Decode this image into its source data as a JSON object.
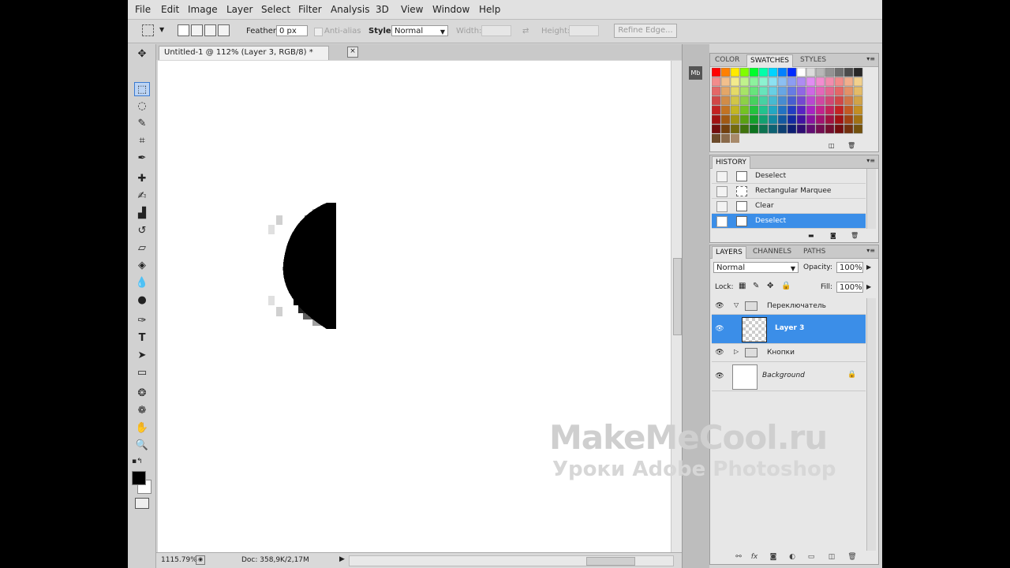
{
  "menu": [
    "File",
    "Edit",
    "Image",
    "Layer",
    "Select",
    "Filter",
    "Analysis",
    "3D",
    "View",
    "Window",
    "Help"
  ],
  "options": {
    "feather_label": "Feather:",
    "feather_value": "0 px",
    "antialias_label": "Anti-alias",
    "style_label": "Style:",
    "style_value": "Normal",
    "width_label": "Width:",
    "height_label": "Height:",
    "refine_edge": "Refine Edge..."
  },
  "document": {
    "tab_title": "Untitled-1 @ 112% (Layer 3, RGB/8) *",
    "zoom_status": "1115.79%",
    "doc_status": "Doc: 358,9K/2,17M"
  },
  "swatches_panel": {
    "tabs": [
      "COLOR",
      "SWATCHES",
      "STYLES"
    ],
    "active_tab": "SWATCHES"
  },
  "history_panel": {
    "title": "HISTORY",
    "items": [
      {
        "label": "Deselect",
        "active": false
      },
      {
        "label": "Rectangular Marquee",
        "active": false
      },
      {
        "label": "Clear",
        "active": false
      },
      {
        "label": "Deselect",
        "active": true
      }
    ]
  },
  "layers_panel": {
    "tabs": [
      "LAYERS",
      "CHANNELS",
      "PATHS"
    ],
    "blend_mode": "Normal",
    "opacity_label": "Opacity:",
    "opacity_value": "100%",
    "lock_label": "Lock:",
    "fill_label": "Fill:",
    "fill_value": "100%",
    "layers": [
      {
        "name": "Переключатель",
        "type": "group",
        "expanded": true
      },
      {
        "name": "Layer 3",
        "type": "layer",
        "selected": true
      },
      {
        "name": "Кнопки",
        "type": "group",
        "expanded": false
      },
      {
        "name": "Background",
        "type": "background",
        "locked": true
      }
    ]
  },
  "watermark": {
    "line1": "MakeMeCool.ru",
    "line2": "Уроки Adobe Photoshop"
  },
  "colors": {
    "selection_blue": "#3b8ee8",
    "ui_gray": "#d4d4d4"
  }
}
